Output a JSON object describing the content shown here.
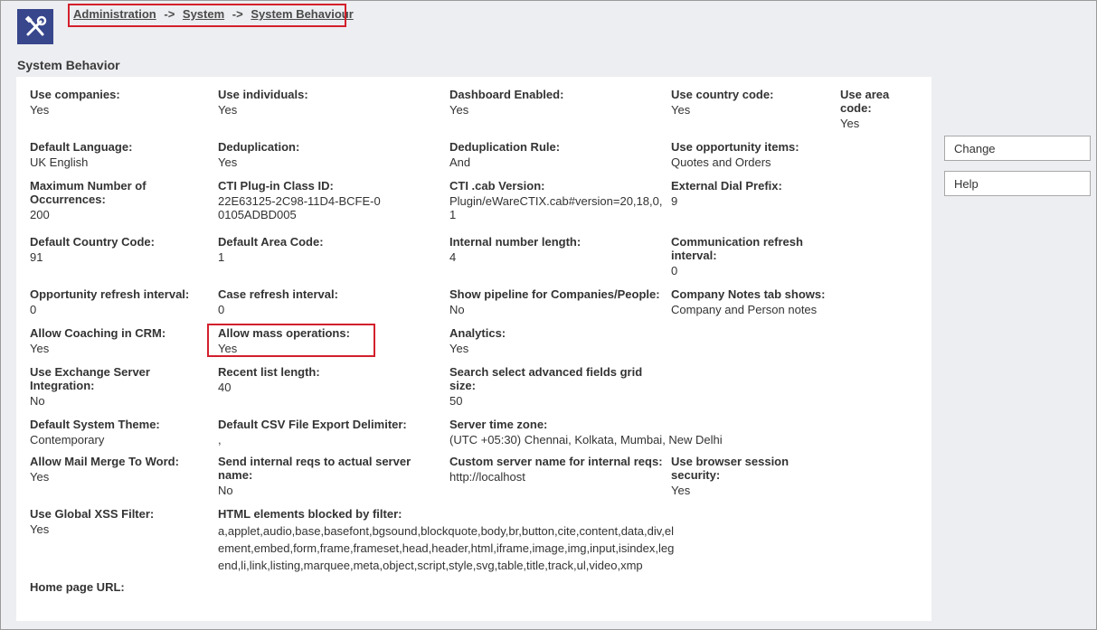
{
  "breadcrumb": {
    "items": [
      "Administration",
      "System",
      "System Behaviour"
    ],
    "separator": "->"
  },
  "app_icon": "tools-icon",
  "page_title": "System Behavior",
  "buttons": {
    "change": "Change",
    "help": "Help"
  },
  "fields": {
    "use_companies": {
      "label": "Use companies:",
      "value": "Yes"
    },
    "use_individuals": {
      "label": "Use individuals:",
      "value": "Yes"
    },
    "dashboard_enabled": {
      "label": "Dashboard Enabled:",
      "value": "Yes"
    },
    "use_country_code": {
      "label": "Use country code:",
      "value": "Yes"
    },
    "use_area_code": {
      "label": "Use area code:",
      "value": "Yes"
    },
    "default_language": {
      "label": "Default Language:",
      "value": "UK English"
    },
    "deduplication": {
      "label": "Deduplication:",
      "value": "Yes"
    },
    "deduplication_rule": {
      "label": "Deduplication Rule:",
      "value": "And"
    },
    "use_opportunity_items": {
      "label": "Use opportunity items:",
      "value": "Quotes and Orders"
    },
    "max_occurrences": {
      "label": "Maximum Number of Occurrences:",
      "value": "200"
    },
    "cti_plugin_class_id": {
      "label": "CTI Plug-in Class ID:",
      "value": "22E63125-2C98-11D4-BCFE-00105ADBD005"
    },
    "cti_cab_version": {
      "label": "CTI .cab Version:",
      "value": "Plugin/eWareCTIX.cab#version=20,18,0,1"
    },
    "external_dial_prefix": {
      "label": "External Dial Prefix:",
      "value": "9"
    },
    "default_country_code": {
      "label": "Default Country Code:",
      "value": "91"
    },
    "default_area_code": {
      "label": "Default Area Code:",
      "value": "1"
    },
    "internal_number_length": {
      "label": "Internal number length:",
      "value": "4"
    },
    "communication_refresh_interval": {
      "label": "Communication refresh interval:",
      "value": "0"
    },
    "opportunity_refresh_interval": {
      "label": "Opportunity refresh interval:",
      "value": "0"
    },
    "case_refresh_interval": {
      "label": "Case refresh interval:",
      "value": "0"
    },
    "show_pipeline": {
      "label": "Show pipeline for Companies/People:",
      "value": "No"
    },
    "company_notes_tab": {
      "label": "Company Notes tab shows:",
      "value": "Company and Person notes"
    },
    "allow_coaching": {
      "label": "Allow Coaching in CRM:",
      "value": "Yes"
    },
    "allow_mass_operations": {
      "label": "Allow mass operations:",
      "value": "Yes"
    },
    "analytics": {
      "label": "Analytics:",
      "value": "Yes"
    },
    "use_exchange": {
      "label": "Use Exchange Server Integration:",
      "value": "No"
    },
    "recent_list_length": {
      "label": "Recent list length:",
      "value": "40"
    },
    "search_select_grid_size": {
      "label": "Search select advanced fields grid size:",
      "value": "50"
    },
    "default_system_theme": {
      "label": "Default System Theme:",
      "value": "Contemporary"
    },
    "csv_export_delimiter": {
      "label": "Default CSV File Export Delimiter:",
      "value": ","
    },
    "server_time_zone": {
      "label": "Server time zone:",
      "value": "(UTC +05:30) Chennai, Kolkata, Mumbai, New Delhi"
    },
    "allow_mail_merge": {
      "label": "Allow Mail Merge To Word:",
      "value": "Yes"
    },
    "send_internal_reqs": {
      "label": "Send internal reqs to actual server name:",
      "value": "No"
    },
    "custom_server_name": {
      "label": "Custom server name for internal reqs:",
      "value": "http://localhost"
    },
    "browser_session_security": {
      "label": "Use browser session security:",
      "value": "Yes"
    },
    "global_xss_filter": {
      "label": "Use Global XSS Filter:",
      "value": "Yes"
    },
    "html_elements_blocked": {
      "label": "HTML elements blocked by filter:",
      "value": "a,applet,audio,base,basefont,bgsound,blockquote,body,br,button,cite,content,data,div,element,embed,form,frame,frameset,head,header,html,iframe,image,img,input,isindex,legend,li,link,listing,marquee,meta,object,script,style,svg,table,title,track,ul,video,xmp"
    },
    "home_page_url": {
      "label": "Home page URL:",
      "value": ""
    }
  }
}
